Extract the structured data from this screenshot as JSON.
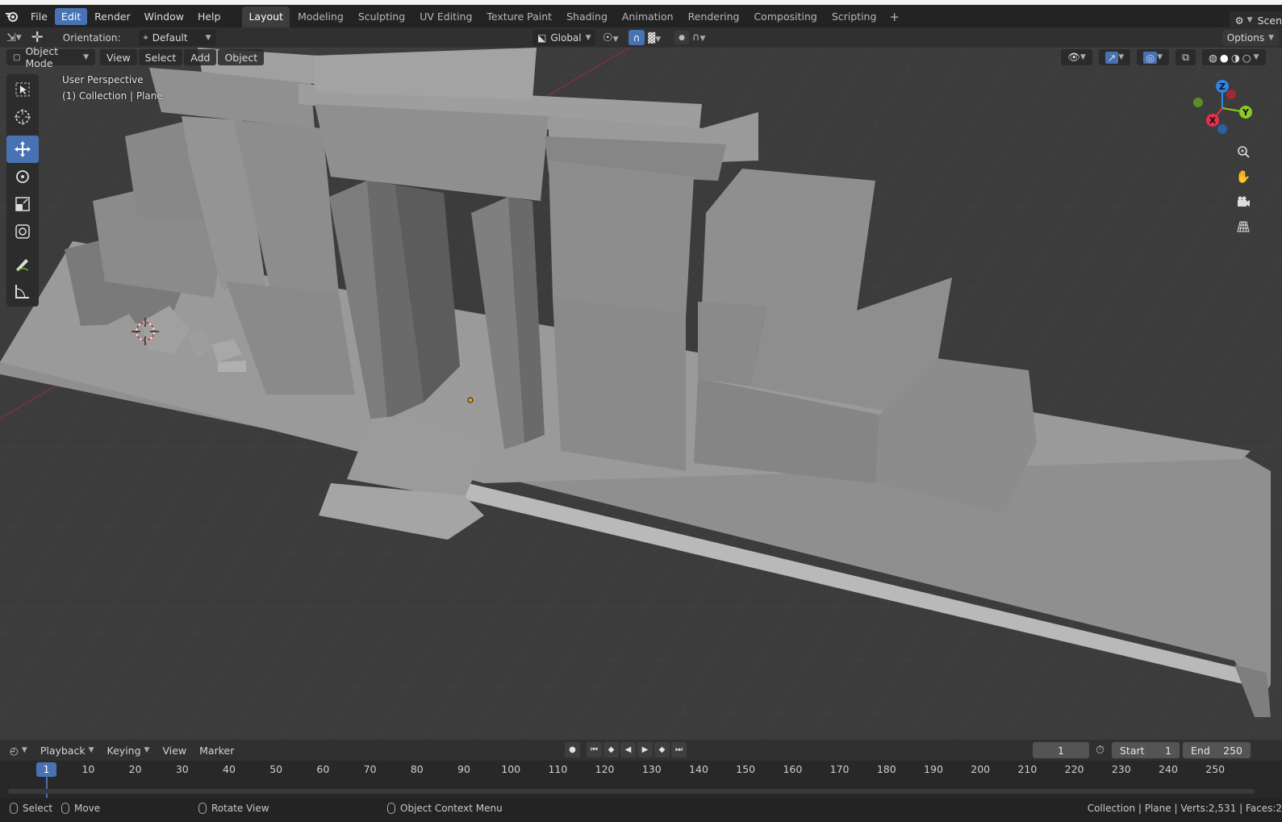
{
  "menu": {
    "items": [
      "File",
      "Edit",
      "Render",
      "Window",
      "Help"
    ],
    "active": "Edit"
  },
  "workspaces": {
    "tabs": [
      "Layout",
      "Modeling",
      "Sculpting",
      "UV Editing",
      "Texture Paint",
      "Shading",
      "Animation",
      "Rendering",
      "Compositing",
      "Scripting"
    ],
    "active": "Layout",
    "add_label": "+"
  },
  "scene": {
    "label": "Scen"
  },
  "tool_header": {
    "orientation_label": "Orientation:",
    "orientation_value": "Default",
    "transform_orientation": "Global",
    "options_label": "Options"
  },
  "viewport_header": {
    "mode": "Object Mode",
    "menus": [
      "View",
      "Select",
      "Add",
      "Object"
    ]
  },
  "viewport": {
    "perspective_label": "User Perspective",
    "collection_label": "(1) Collection | Plane"
  },
  "toolbox": {
    "tools": [
      "select-box-tool",
      "cursor-tool",
      "move-tool",
      "rotate-tool",
      "scale-tool",
      "transform-tool",
      "annotate-tool",
      "measure-tool"
    ],
    "active": "move-tool"
  },
  "gizmo": {
    "x": "X",
    "y": "Y",
    "z": "Z"
  },
  "timeline": {
    "menus": [
      "Playback",
      "Keying",
      "View",
      "Marker"
    ],
    "current_frame": "1",
    "start_label": "Start",
    "start_value": "1",
    "end_label": "End",
    "end_value": "250",
    "ruler": [
      "10",
      "20",
      "30",
      "40",
      "50",
      "60",
      "70",
      "80",
      "90",
      "100",
      "110",
      "120",
      "130",
      "140",
      "150",
      "160",
      "170",
      "180",
      "190",
      "200",
      "210",
      "220",
      "230",
      "240",
      "250"
    ],
    "ruler_current": "1"
  },
  "statusbar": {
    "select": "Select",
    "move": "Move",
    "rotate": "Rotate View",
    "context": "Object Context Menu",
    "info": "Collection | Plane | Verts:2,531 | Faces:2"
  },
  "colors": {
    "accent": "#4772b3",
    "background": "#3c3c3c",
    "axis_x": "#e0334b",
    "axis_y": "#8ac926",
    "axis_z": "#2f86e6"
  }
}
